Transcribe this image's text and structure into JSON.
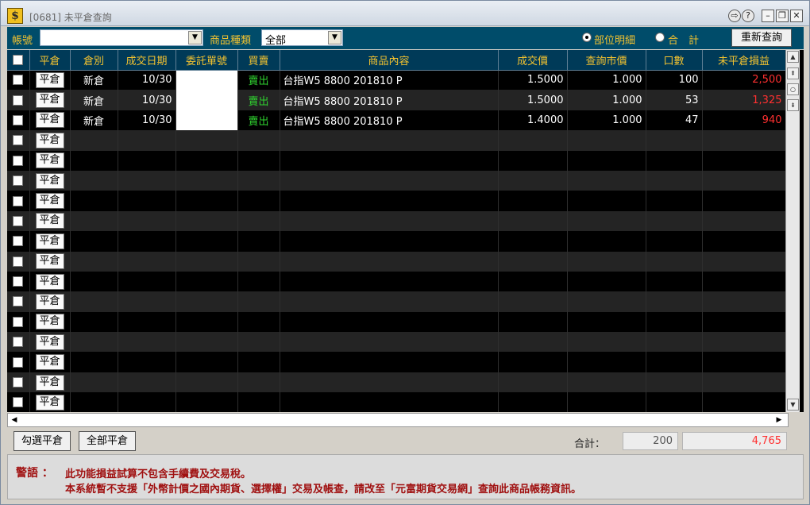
{
  "window": {
    "title": "[0681] 未平倉查詢",
    "app_icon": "$"
  },
  "toolbar": {
    "account_label": "帳號",
    "account_value": "",
    "product_type_label": "商品種類",
    "product_type_value": "全部",
    "radio_detail": "部位明細",
    "radio_total": "合　計",
    "refresh": "重新查詢"
  },
  "table": {
    "headers": [
      "平倉",
      "倉別",
      "成交日期",
      "委託單號",
      "買賣",
      "商品內容",
      "成交價",
      "查詢市價",
      "口數",
      "未平倉損益"
    ],
    "close_button": "平倉",
    "rows": [
      {
        "type": "新倉",
        "date": "10/30",
        "order": "",
        "side": "賣出",
        "product": "台指W5 8800 201810 P",
        "price": "1.5000",
        "market": "1.000",
        "qty": "100",
        "pnl": "2,500"
      },
      {
        "type": "新倉",
        "date": "10/30",
        "order": "",
        "side": "賣出",
        "product": "台指W5 8800 201810 P",
        "price": "1.5000",
        "market": "1.000",
        "qty": "53",
        "pnl": "1,325"
      },
      {
        "type": "新倉",
        "date": "10/30",
        "order": "",
        "side": "賣出",
        "product": "台指W5 8800 201810 P",
        "price": "1.4000",
        "market": "1.000",
        "qty": "47",
        "pnl": "940"
      }
    ],
    "empty_row_count": 14
  },
  "footer": {
    "select_close": "勾選平倉",
    "close_all": "全部平倉",
    "total_label": "合計：",
    "total_qty": "200",
    "total_pnl": "4,765"
  },
  "note": {
    "label": "警語 ：",
    "line1": "此功能損益試算不包含手續費及交易稅。",
    "line2": "本系統暫不支援「外幣計價之國內期貨、選擇權」交易及帳查，請改至「元富期貨交易網」查詢此商品帳務資訊。"
  },
  "colors": {
    "header_bg": "#003a58",
    "accent": "#f2c230",
    "sell": "#2fd22f",
    "pnl": "#ff3030"
  }
}
